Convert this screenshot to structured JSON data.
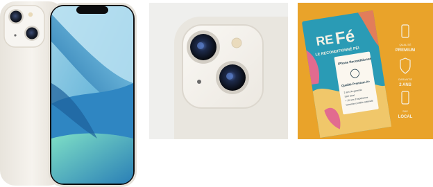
{
  "gallery": {
    "box": {
      "brand_re": "RE",
      "brand_fe": "Fé",
      "tagline": "LE RECONDITIONNÉ PÉI",
      "label_title": "iPhone Reconditionné",
      "label_quality": "Qualité Premium A+",
      "label_bullets": [
        "2 ans de garantie",
        "SAV local",
        "+ 10 ans d'expérience",
        "Garantie certifiée optimale"
      ]
    },
    "badges": [
      {
        "top": "QUALITÉ",
        "bottom": "PREMIUM"
      },
      {
        "top": "GARANTIE",
        "bottom": "2 ANS"
      },
      {
        "top": "SAV",
        "bottom": "LOCAL"
      }
    ],
    "colors": {
      "phone_body": "#f1ede6",
      "camera_bump": "#f5f3ee",
      "crop_background": "#efefed",
      "box_background": "#e9a32a",
      "box_blue": "#2a9bb5",
      "box_text": "#f6f2e6"
    }
  }
}
